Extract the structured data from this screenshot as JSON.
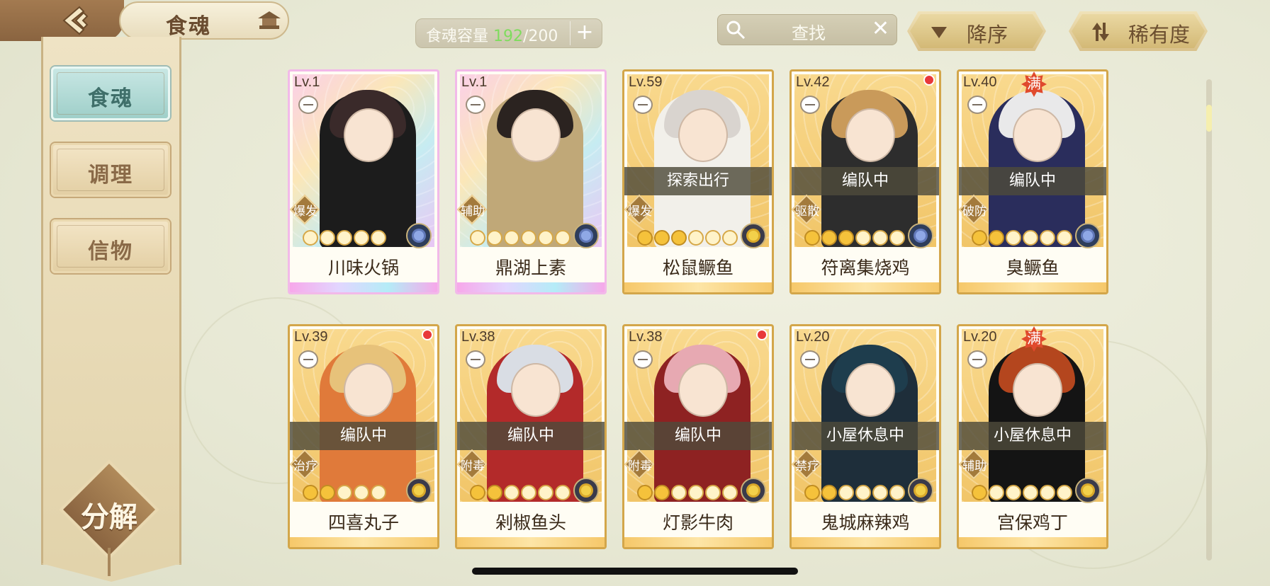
{
  "header": {
    "title": "食魂",
    "capacity_label": "食魂容量",
    "capacity_current": "192",
    "capacity_total": "/200",
    "capacity_add": "+",
    "search_label": "查找",
    "search_clear": "✕",
    "sort_order": "降序",
    "sort_by": "稀有度",
    "icons": {
      "back": "back-arrow-icon",
      "pagoda": "pagoda-icon",
      "search": "magnifier-icon",
      "sort_order": "triangle-down-icon",
      "sort_by": "swap-icon"
    }
  },
  "sidebar": {
    "items": [
      {
        "label": "食魂",
        "active": true
      },
      {
        "label": "调理",
        "active": false
      },
      {
        "label": "信物",
        "active": false
      }
    ],
    "decompose_label": "分解"
  },
  "cards": [
    {
      "level": "Lv.1",
      "name": "川味火锅",
      "role": "爆发",
      "status": "",
      "stars": 5,
      "lit": 0,
      "rainbow": true,
      "dot": false,
      "full": "",
      "flower": "blue"
    },
    {
      "level": "Lv.1",
      "name": "鼎湖上素",
      "role": "辅助",
      "status": "",
      "stars": 6,
      "lit": 0,
      "rainbow": true,
      "dot": false,
      "full": "",
      "flower": "blue"
    },
    {
      "level": "Lv.59",
      "name": "松鼠鳜鱼",
      "role": "爆发",
      "status": "探索出行",
      "stars": 6,
      "lit": 3,
      "rainbow": false,
      "dot": false,
      "full": "",
      "flower": "gold"
    },
    {
      "level": "Lv.42",
      "name": "符离集烧鸡",
      "role": "驱散",
      "status": "编队中",
      "stars": 6,
      "lit": 3,
      "rainbow": false,
      "dot": true,
      "full": "",
      "flower": "blue"
    },
    {
      "level": "Lv.40",
      "name": "臭鳜鱼",
      "role": "破防",
      "status": "编队中",
      "stars": 6,
      "lit": 2,
      "rainbow": false,
      "dot": false,
      "full": "满",
      "flower": "blue"
    },
    {
      "level": "Lv.39",
      "name": "四喜丸子",
      "role": "治疗",
      "status": "编队中",
      "stars": 5,
      "lit": 2,
      "rainbow": false,
      "dot": true,
      "full": "",
      "flower": "gold"
    },
    {
      "level": "Lv.38",
      "name": "剁椒鱼头",
      "role": "附毒",
      "status": "编队中",
      "stars": 6,
      "lit": 2,
      "rainbow": false,
      "dot": false,
      "full": "",
      "flower": "gold"
    },
    {
      "level": "Lv.38",
      "name": "灯影牛肉",
      "role": "附毒",
      "status": "编队中",
      "stars": 6,
      "lit": 2,
      "rainbow": false,
      "dot": true,
      "full": "",
      "flower": "gold"
    },
    {
      "level": "Lv.20",
      "name": "鬼城麻辣鸡",
      "role": "禁疗",
      "status": "小屋休息中",
      "stars": 6,
      "lit": 2,
      "rainbow": false,
      "dot": false,
      "full": "",
      "flower": "gold"
    },
    {
      "level": "Lv.20",
      "name": "宫保鸡丁",
      "role": "辅助",
      "status": "小屋休息中",
      "stars": 6,
      "lit": 1,
      "rainbow": false,
      "dot": false,
      "full": "满",
      "flower": "gold"
    }
  ],
  "colors": {
    "card_border": "#d3a64a",
    "capacity_current": "#7fdc5e",
    "nav_active": "#9fcfc9",
    "red_dot": "#e8383a"
  }
}
